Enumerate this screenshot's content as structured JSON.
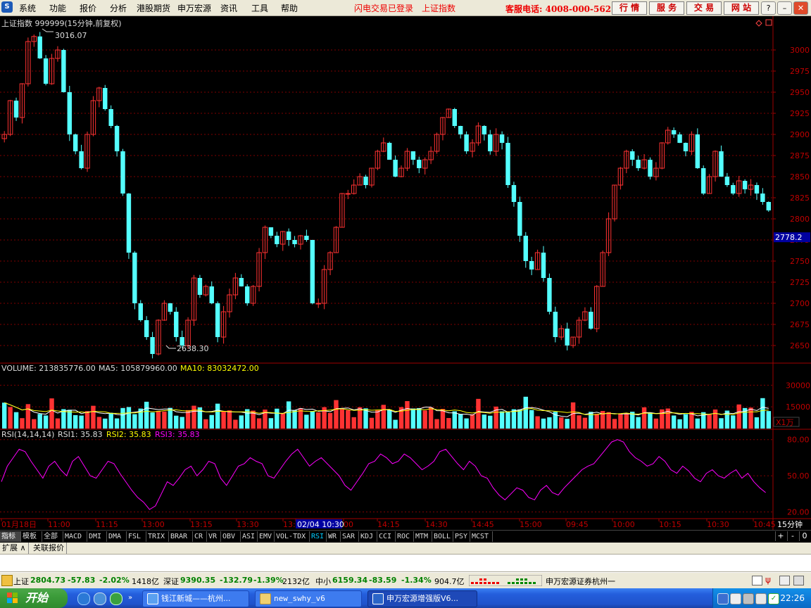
{
  "app": {
    "menu": [
      "系统",
      "功能",
      "报价",
      "分析",
      "港股期货",
      "申万宏源",
      "资讯",
      "工具",
      "帮助"
    ],
    "notice1": "闪电交易已登录",
    "notice2": "上证指数",
    "hotline": "客服电话: 4008-000-562",
    "toolbar_buttons": [
      "行 情",
      "服 务",
      "交 易",
      "网 站"
    ],
    "window_buttons": [
      "?",
      "–",
      "❐",
      "✕"
    ]
  },
  "chart_header": {
    "title": "上证指数 999999(15分钟,前复权)",
    "high_label": "3016.07",
    "low_label": "2638.30",
    "current_price": "2778.2"
  },
  "chart_data": [
    {
      "type": "candlestick",
      "title": "上证指数 999999(15分钟,前复权)",
      "y_ticks": [
        3000,
        2975,
        2950,
        2925,
        2900,
        2875,
        2850,
        2825,
        2800,
        2775,
        2750,
        2725,
        2700,
        2675,
        2650
      ],
      "ylim": [
        2630,
        3030
      ],
      "high": 3016.07,
      "low": 2638.3,
      "last": 2778.2,
      "path_closes": [
        2900,
        2940,
        2920,
        2960,
        3010,
        3016,
        2990,
        2960,
        2990,
        3000,
        2950,
        2900,
        2880,
        2860,
        2900,
        2940,
        2955,
        2930,
        2910,
        2880,
        2830,
        2760,
        2700,
        2680,
        2660,
        2640,
        2680,
        2700,
        2690,
        2660,
        2650,
        2680,
        2730,
        2710,
        2720,
        2700,
        2660,
        2690,
        2710,
        2730,
        2720,
        2700,
        2720,
        2760,
        2790,
        2780,
        2770,
        2785,
        2775,
        2770,
        2780,
        2775,
        2700,
        2700,
        2740,
        2760,
        2790,
        2830,
        2830,
        2840,
        2850,
        2840,
        2860,
        2880,
        2890,
        2870,
        2850,
        2860,
        2880,
        2870,
        2860,
        2870,
        2880,
        2900,
        2920,
        2930,
        2910,
        2900,
        2880,
        2890,
        2910,
        2900,
        2880,
        2900,
        2890,
        2840,
        2820,
        2780,
        2750,
        2740,
        2760,
        2730,
        2690,
        2660,
        2670,
        2650,
        2660,
        2680,
        2690,
        2670,
        2720,
        2760,
        2800,
        2840,
        2860,
        2880,
        2870,
        2860,
        2870,
        2850,
        2860,
        2890,
        2905,
        2900,
        2890,
        2880,
        2900,
        2860,
        2830,
        2850,
        2880,
        2850,
        2840,
        2830,
        2845,
        2835,
        2840,
        2830,
        2820,
        2810
      ]
    },
    {
      "type": "bar",
      "title": "VOLUME",
      "series": [
        {
          "name": "VOLUME",
          "value": 213835776.0
        },
        {
          "name": "MA5",
          "value": 105879960.0
        },
        {
          "name": "MA10",
          "value": 83032472.0
        }
      ],
      "y_ticks": [
        30000,
        15000
      ],
      "unit": "X1万"
    },
    {
      "type": "line",
      "title": "RSI(14,14,14)",
      "series": [
        {
          "name": "RSI1",
          "value": 35.83
        },
        {
          "name": "RSI2",
          "value": 35.83
        },
        {
          "name": "RSI3",
          "value": 35.83
        }
      ],
      "y_ticks": [
        80.0,
        50.0,
        20.0
      ],
      "ylim": [
        15,
        88
      ],
      "values": [
        45,
        58,
        65,
        72,
        70,
        62,
        55,
        48,
        58,
        62,
        55,
        50,
        62,
        66,
        58,
        50,
        48,
        55,
        62,
        60,
        52,
        45,
        38,
        32,
        28,
        22,
        25,
        35,
        45,
        42,
        48,
        55,
        58,
        50,
        55,
        62,
        60,
        48,
        42,
        50,
        58,
        60,
        65,
        62,
        60,
        50,
        48,
        55,
        62,
        68,
        72,
        65,
        58,
        62,
        65,
        60,
        55,
        50,
        42,
        38,
        45,
        52,
        60,
        62,
        68,
        65,
        60,
        62,
        68,
        65,
        60,
        55,
        58,
        62,
        70,
        72,
        66,
        60,
        55,
        62,
        58,
        50,
        48,
        40,
        34,
        30,
        35,
        40,
        38,
        32,
        30,
        38,
        42,
        36,
        34,
        40,
        45,
        50,
        55,
        58,
        60,
        66,
        72,
        78,
        80,
        78,
        70,
        65,
        62,
        58,
        60,
        66,
        62,
        55,
        52,
        58,
        54,
        48,
        45,
        52,
        55,
        50,
        48,
        52,
        55,
        48,
        52,
        45,
        40,
        36
      ]
    },
    {
      "type": "table",
      "title": "time_axis",
      "x_ticks": [
        "01月18日",
        "11:00",
        "11:15",
        "13:00",
        "13:15",
        "13:30",
        "13:",
        "02/04 10:30",
        "00",
        "14:15",
        "14:30",
        "14:45",
        "15:00",
        "09:45",
        "10:00",
        "10:15",
        "10:30",
        "10:45"
      ],
      "period": "15分钟"
    }
  ],
  "volume_header": {
    "vol_label": "VOLUME: 213835776.00",
    "ma5_label": "MA5: 105879960.00",
    "ma10_label": "MA10: 83032472.00",
    "unit": "X1万"
  },
  "rsi_header": {
    "name": "RSI(14,14,14)",
    "rsi1": "RSI1: 35.83",
    "rsi2": "RSI2: 35.83",
    "rsi3": "RSI3: 35.83"
  },
  "time_labels": [
    "01月18日",
    "11:00",
    "11:15",
    "13:00",
    "13:15",
    "13:30",
    "13:",
    "02/04 10:30",
    "00",
    "14:15",
    "14:30",
    "14:45",
    "15:00",
    "09:45",
    "10:00",
    "10:15",
    "10:30",
    "10:45"
  ],
  "period_label": "15分钟",
  "indicator_tabs": [
    "指标",
    "模板",
    "全部",
    "MACD",
    "DMI",
    "DMA",
    "FSL",
    "TRIX",
    "BRAR",
    "CR",
    "VR",
    "OBV",
    "ASI",
    "EMV",
    "VOL-TDX",
    "RSI",
    "WR",
    "SAR",
    "KDJ",
    "CCI",
    "ROC",
    "MTM",
    "BOLL",
    "PSY",
    "MCST"
  ],
  "tab_controls": [
    "+",
    "-",
    "0"
  ],
  "extend_tabs": [
    "扩展 ∧",
    "关联报价"
  ],
  "status": {
    "sh_name": "上证",
    "sh_value": "2804.73",
    "sh_change": "-57.83",
    "sh_pct": "-2.02%",
    "sh_amount": "1418亿",
    "sz_name": "深证",
    "sz_value": "9390.35",
    "sz_change": "-132.79",
    "sz_pct": "-1.39%",
    "sz_amount": "2132亿",
    "zx_name": "中小",
    "zx_value": "6159.34",
    "zx_change": "-83.59",
    "zx_pct": "-1.34%",
    "zx_amount": "904.7亿",
    "broker": "申万宏源证券杭州一"
  },
  "taskbar": {
    "start": "开始",
    "tasks": [
      "钱江新城——杭州...",
      "new_swhy_v6",
      "申万宏源增强版V6..."
    ],
    "clock": "22:26"
  },
  "colors": {
    "up": "#ff3232",
    "down": "#54ffff",
    "ma5": "#ffffff",
    "ma10": "#ffff00",
    "rsi": "#ff00ff",
    "grid": "#800000",
    "axis_text": "#c00000"
  }
}
